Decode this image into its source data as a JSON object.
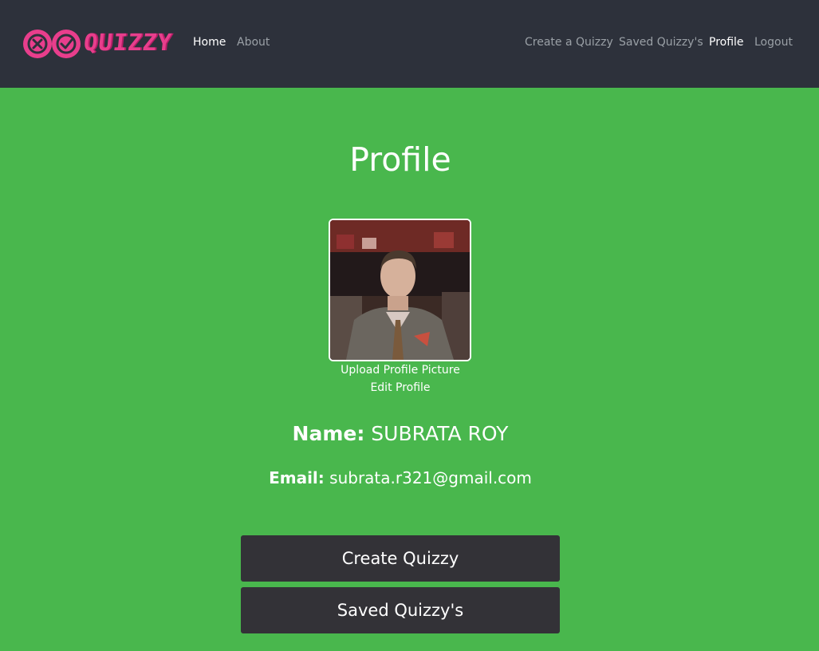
{
  "navbar": {
    "brand": "QUIZZY",
    "left_links": [
      {
        "label": "Home",
        "active": true
      },
      {
        "label": "About",
        "active": false
      }
    ],
    "right_links": [
      {
        "label": "Create a Quizzy",
        "active": false
      },
      {
        "label": "Saved Quizzy's",
        "active": false
      },
      {
        "label": "Profile",
        "active": true
      },
      {
        "label": "Logout",
        "active": false
      }
    ]
  },
  "profile": {
    "title": "Profile",
    "upload_label": "Upload Profile Picture",
    "edit_label": "Edit Profile",
    "name_label": "Name:",
    "name_value": "SUBRATA ROY",
    "email_label": "Email:",
    "email_value": "subrata.r321@gmail.com"
  },
  "actions": {
    "create_label": "Create Quizzy",
    "saved_label": "Saved Quizzy's"
  },
  "colors": {
    "navbar_bg": "#2d313b",
    "page_bg": "#49b74d",
    "brand_pink": "#e83e8c",
    "button_bg": "#333237"
  }
}
